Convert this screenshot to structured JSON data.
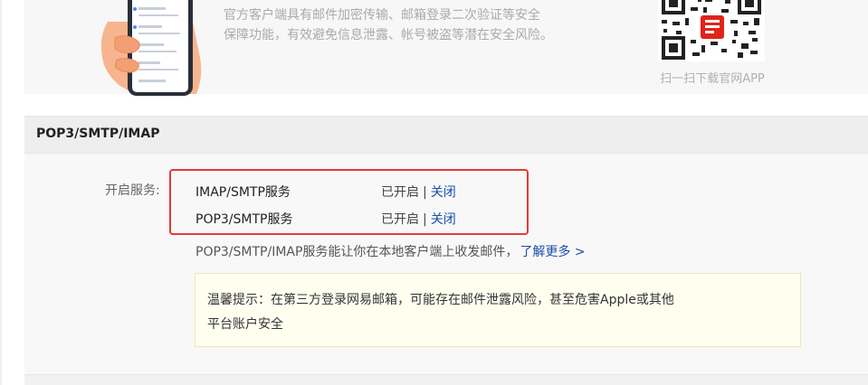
{
  "promo": {
    "line1": "官方客户端具有邮件加密传输、邮箱登录二次验证等安全",
    "line2": "保障功能，有效避免信息泄露、帐号被盗等潜在安全风险。",
    "qr_caption": "扫一扫下载官网APP"
  },
  "section": {
    "title": "POP3/SMTP/IMAP",
    "services_label": "开启服务:",
    "services": [
      {
        "name": "IMAP/SMTP服务",
        "status": "已开启",
        "action": "关闭"
      },
      {
        "name": "POP3/SMTP服务",
        "status": "已开启",
        "action": "关闭"
      }
    ],
    "separator": "|",
    "description": "POP3/SMTP/IMAP服务能让你在本地客户端上收发邮件，",
    "learn_more": "了解更多 >",
    "warning_line1": "温馨提示：在第三方登录网易邮箱，可能存在邮件泄露风险，甚至危害Apple或其他",
    "warning_line2": "平台账户安全"
  },
  "colors": {
    "link": "#1a4ea8",
    "highlight_border": "#e53935",
    "warning_bg": "#fffff0"
  }
}
